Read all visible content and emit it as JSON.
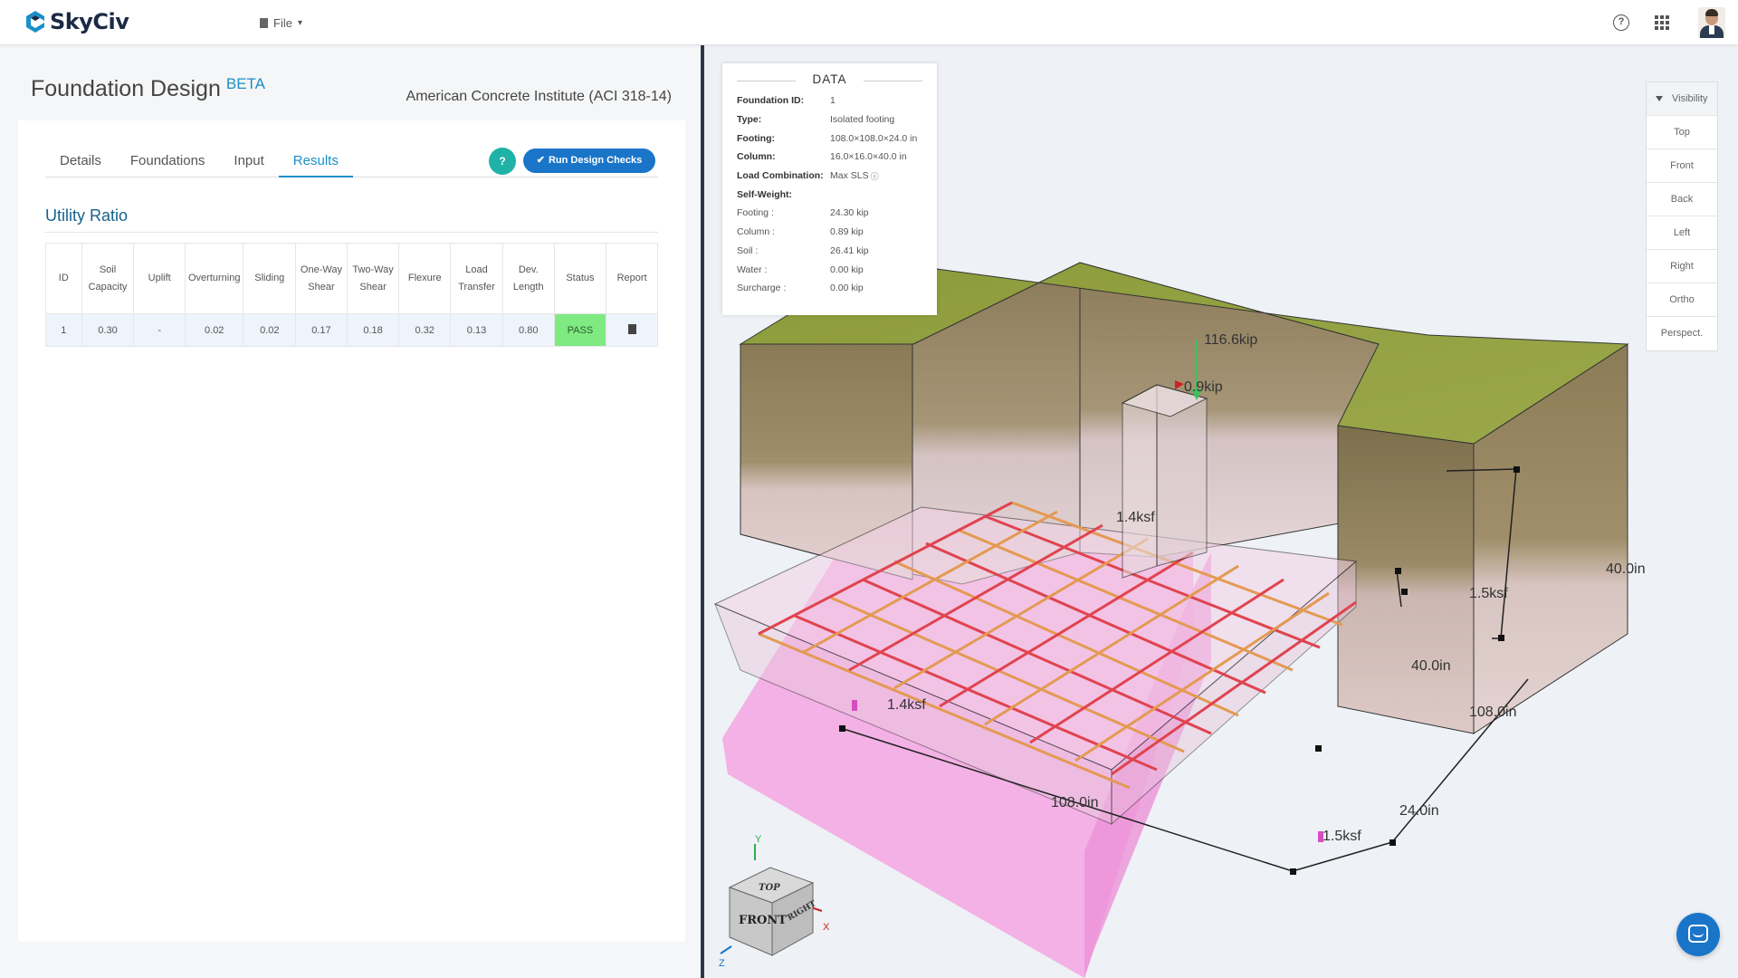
{
  "app": {
    "logo": "SkyCiv",
    "file_menu": "File",
    "icons": [
      "help-icon",
      "apps-grid-icon",
      "user-avatar"
    ]
  },
  "panel": {
    "title": "Foundation Design",
    "badge": "BETA",
    "standard": "American Concrete Institute (ACI 318-14)",
    "tabs": [
      "Details",
      "Foundations",
      "Input",
      "Results"
    ],
    "active_tab": "Results",
    "help_button": "?",
    "run_button": "Run Design Checks"
  },
  "utility_ratio": {
    "title": "Utility Ratio",
    "headers": [
      "ID",
      "Soil Capacity",
      "Uplift",
      "Overturning",
      "Sliding",
      "One-Way Shear",
      "Two-Way Shear",
      "Flexure",
      "Load Transfer",
      "Dev. Length",
      "Status",
      "Report"
    ],
    "rows": [
      [
        "1",
        "0.30",
        "-",
        "0.02",
        "0.02",
        "0.17",
        "0.18",
        "0.32",
        "0.13",
        "0.80",
        "PASS",
        "report-icon"
      ]
    ]
  },
  "data_panel": {
    "title": "DATA",
    "rows": [
      {
        "key": "Foundation ID:",
        "value": "1"
      },
      {
        "key": "Type:",
        "value": "Isolated footing"
      },
      {
        "key": "Footing:",
        "value": "108.0×108.0×24.0 in"
      },
      {
        "key": "Column:",
        "value": "16.0×16.0×40.0 in"
      },
      {
        "key": "Load Combination:",
        "value": "Max SLS"
      },
      {
        "key": "Self-Weight:",
        "value": ""
      },
      {
        "key": "Footing :",
        "value": "24.30 kip"
      },
      {
        "key": "Column :",
        "value": "0.89 kip"
      },
      {
        "key": "Soil :",
        "value": "26.41 kip"
      },
      {
        "key": "Water :",
        "value": "0.00 kip"
      },
      {
        "key": "Surcharge :",
        "value": "0.00 kip"
      }
    ]
  },
  "view_buttons": [
    "Visibility",
    "Top",
    "Front",
    "Back",
    "Left",
    "Right",
    "Ortho",
    "Perspect."
  ],
  "model_labels": {
    "axial_load": "116.6kip",
    "moment_load": "0.9kip",
    "pressure_back_left": "1.4ksf",
    "pressure_right": "1.5ksf",
    "pressure_front_left": "1.4ksf",
    "pressure_front_right": "1.5ksf",
    "dim_depth_soil": "40.0in",
    "dim_column_height": "40.0in",
    "dim_width_right": "108.0in",
    "dim_width_front": "108.0in",
    "dim_thickness": "24.0in",
    "axis_y": "Y",
    "axis_x": "X",
    "axis_z": "Z",
    "cube_top": "TOP",
    "cube_front": "FRONT",
    "cube_right": "RIGHT"
  },
  "colors": {
    "accent": "#1a8fc8",
    "run_button": "#1a75c9",
    "help_button": "#1fb3a7",
    "pass": "#7fea82",
    "grass": "#8c9b3a",
    "soil": "#8a7b58",
    "pressure": "#f07bd6",
    "rebar_red": "#e0434f",
    "rebar_orange": "#e39a52"
  }
}
